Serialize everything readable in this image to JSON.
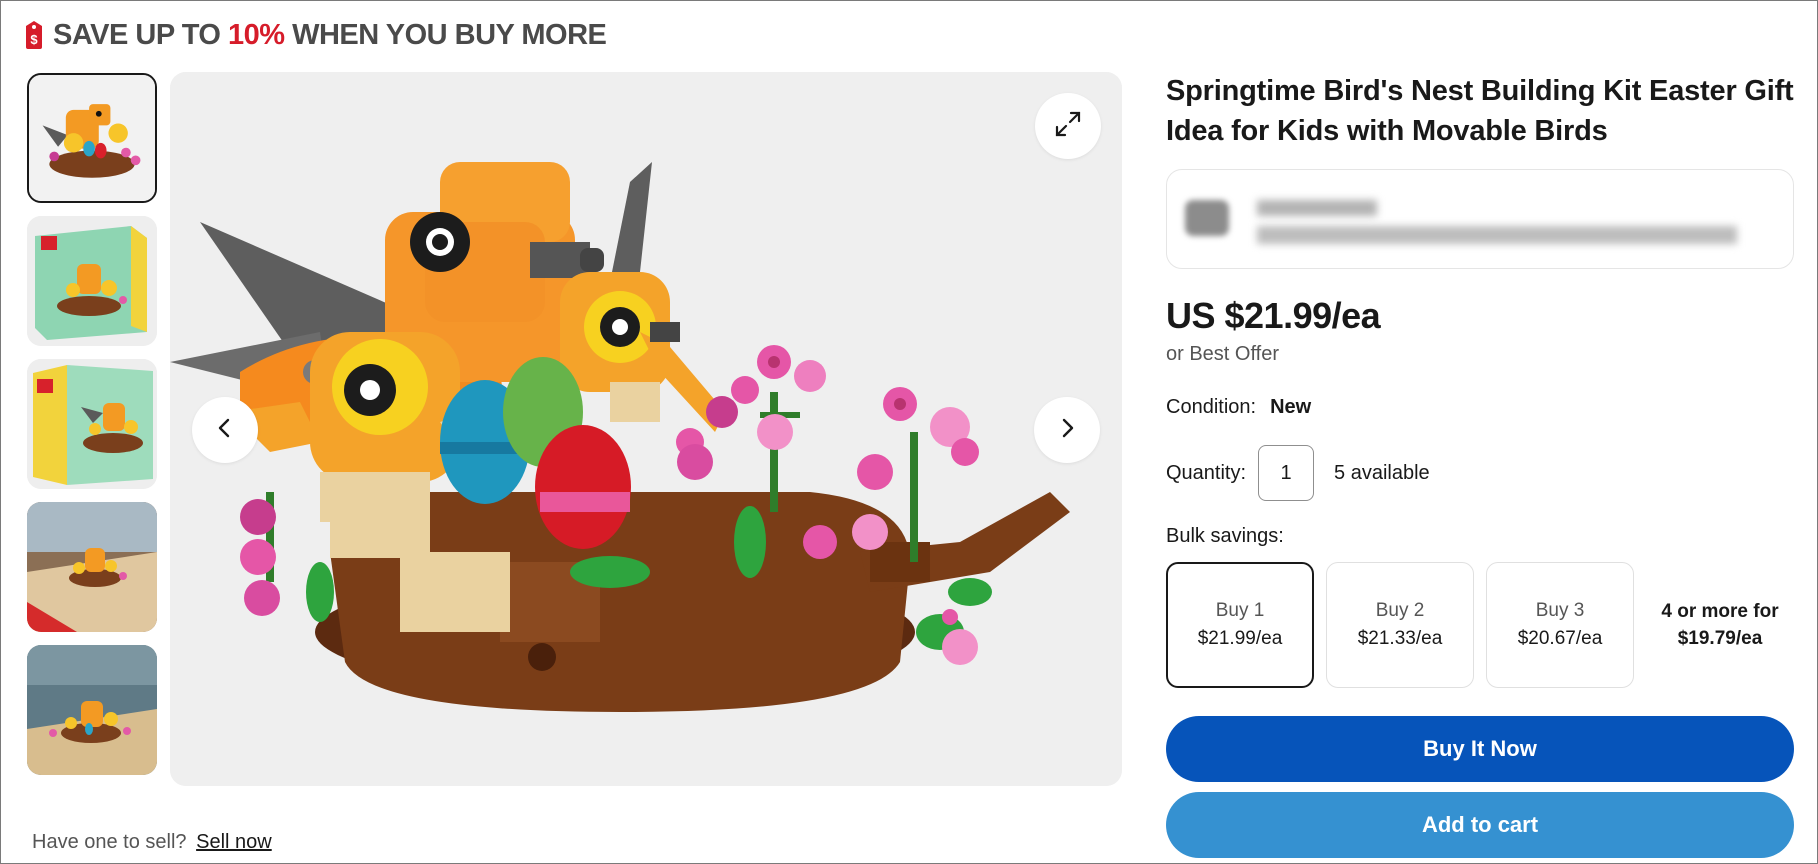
{
  "promo": {
    "prefix": "SAVE UP TO ",
    "highlight": "10%",
    "suffix": " WHEN YOU BUY MORE",
    "highlight_color": "#d61c2a"
  },
  "gallery": {
    "thumbnails": [
      "thumb-front-view",
      "thumb-box-front",
      "thumb-box-angle",
      "thumb-lifestyle-table",
      "thumb-lifestyle-shelf"
    ],
    "selected_index": 0,
    "controls": {
      "expand_icon": "expand-icon",
      "prev_icon": "chevron-left-icon",
      "next_icon": "chevron-right-icon"
    }
  },
  "sell_prompt": {
    "text": "Have one to sell?",
    "link": "Sell now"
  },
  "listing": {
    "title": "Springtime Bird's Nest Building Kit Easter Gift Idea for Kids with Movable Birds",
    "price": "US $21.99/ea",
    "best_offer": "or Best Offer",
    "condition_label": "Condition:",
    "condition_value": "New",
    "quantity_label": "Quantity:",
    "quantity_value": "1",
    "available": "5 available",
    "bulk_label": "Bulk savings:",
    "bulk_options": [
      {
        "qty": "Buy 1",
        "price": "$21.99/ea",
        "selected": true
      },
      {
        "qty": "Buy 2",
        "price": "$21.33/ea",
        "selected": false
      },
      {
        "qty": "Buy 3",
        "price": "$20.67/ea",
        "selected": false
      }
    ],
    "bulk_more": "4 or more for $19.79/ea",
    "buy_now": "Buy It Now",
    "add_to_cart": "Add to cart"
  },
  "colors": {
    "buy_now_bg": "#0654ba",
    "add_to_cart_bg": "#3591d1",
    "text_primary": "#191919",
    "text_secondary": "#555555"
  }
}
